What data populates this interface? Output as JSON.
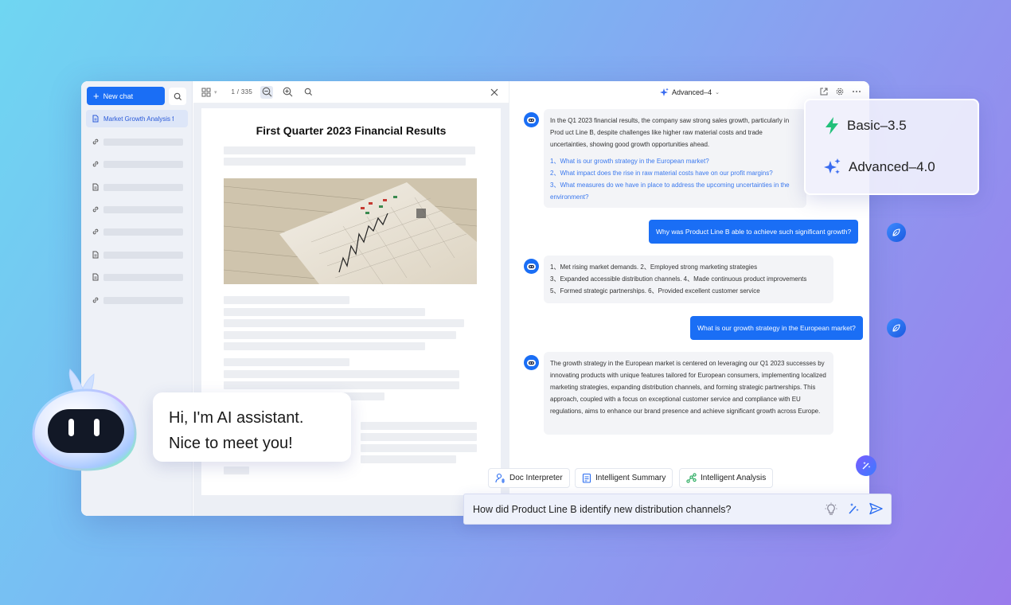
{
  "sidebar": {
    "new_chat_label": "New chat",
    "active_item_label": "Market Growth Analysis f",
    "items": [
      {
        "type": "link"
      },
      {
        "type": "link"
      },
      {
        "type": "doc"
      },
      {
        "type": "link"
      },
      {
        "type": "link"
      },
      {
        "type": "doc"
      },
      {
        "type": "doc"
      },
      {
        "type": "link"
      }
    ]
  },
  "doc_toolbar": {
    "page_indicator": "1 / 335"
  },
  "document": {
    "title": "First Quarter 2023 Financial Results"
  },
  "chat": {
    "model_label": "Advanced–4",
    "messages": {
      "ai1_text": "In the Q1 2023 financial results, the company saw strong sales growth, particularly in Prod uct Line B, despite challenges like higher raw material costs and trade uncertainties, showing good growth opportunities ahead.",
      "ai1_q1": "1、What is our growth strategy in the European market?",
      "ai1_q2": "2、What impact does the rise in raw material costs have on our profit margins?",
      "ai1_q3": "3、What measures do we have in place to address the upcoming uncertainties in the environment?",
      "user1": "Why was Product Line B able to achieve such significant growth?",
      "ai2_line1": "1、Met rising market demands.  2、Employed strong marketing strategies",
      "ai2_line2": "3、Expanded accessible distribution channels. 4、Made continuous product improvements",
      "ai2_line3": "5、Formed strategic partnerships.  6、Provided excellent customer service",
      "user2": "What is our growth strategy in the European market?",
      "ai3_text": "The growth strategy in the European market is centered on leveraging our Q1 2023 successes by innovating products with unique features tailored for European consumers, implementing localized marketing strategies, expanding distribution channels, and forming strategic partnerships. This approach, coupled with a focus on exceptional customer service and compliance with EU regulations, aims to enhance our brand presence and achieve significant growth across Europe."
    },
    "chips": [
      "Doc Interpreter",
      "Intelligent Summary",
      "Intelligent Analysis"
    ],
    "input_value": "How did Product Line B identify new distribution channels?"
  },
  "model_popup": {
    "basic": "Basic–3.5",
    "advanced": "Advanced–4.0"
  },
  "greeting": {
    "line1": "Hi, I'm AI assistant.",
    "line2": "Nice to meet you!"
  },
  "colors": {
    "accent": "#1a6ef5",
    "basic_icon": "#22c07a",
    "advanced_icon": "#3a6cf0"
  }
}
